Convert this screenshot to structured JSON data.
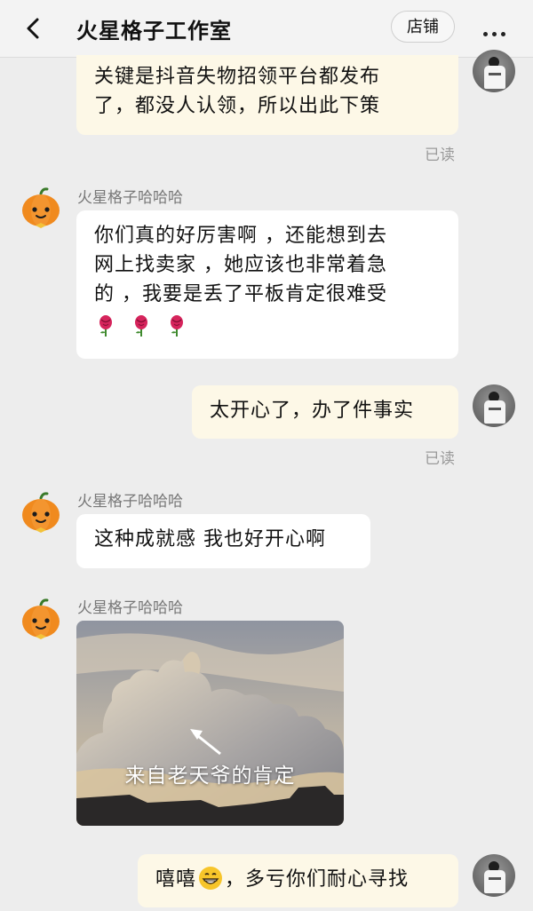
{
  "header": {
    "title": "火星格子工作室",
    "store_label": "店铺"
  },
  "messages": {
    "m1": {
      "line1": "关键是抖音失物招领平台都发布",
      "line2": "了，都没人认领，所以出此下策",
      "status": "已读"
    },
    "m2": {
      "sender": "火星格子哈哈哈",
      "line1": "你们真的好厉害啊 ，还能想到去",
      "line2": "网上找卖家 ，她应该也非常着急",
      "line3": "的 ，我要是丢了平板肯定很难受",
      "emoji": "rose-icon x3"
    },
    "m3": {
      "text": "太开心了，办了件事实",
      "status": "已读"
    },
    "m4": {
      "sender": "火星格子哈哈哈",
      "text": "这种成就感 我也好开心啊"
    },
    "m5": {
      "sender": "火星格子哈哈哈",
      "image_caption": "来自老天爷的肯定"
    },
    "m6": {
      "text_before": "嘻嘻",
      "text_after": "，多亏你们耐心寻找"
    }
  },
  "colors": {
    "my_bubble": "#fdf8e7",
    "their_bubble": "#ffffff",
    "background": "#ededed",
    "pumpkin": "#f08a1e"
  }
}
